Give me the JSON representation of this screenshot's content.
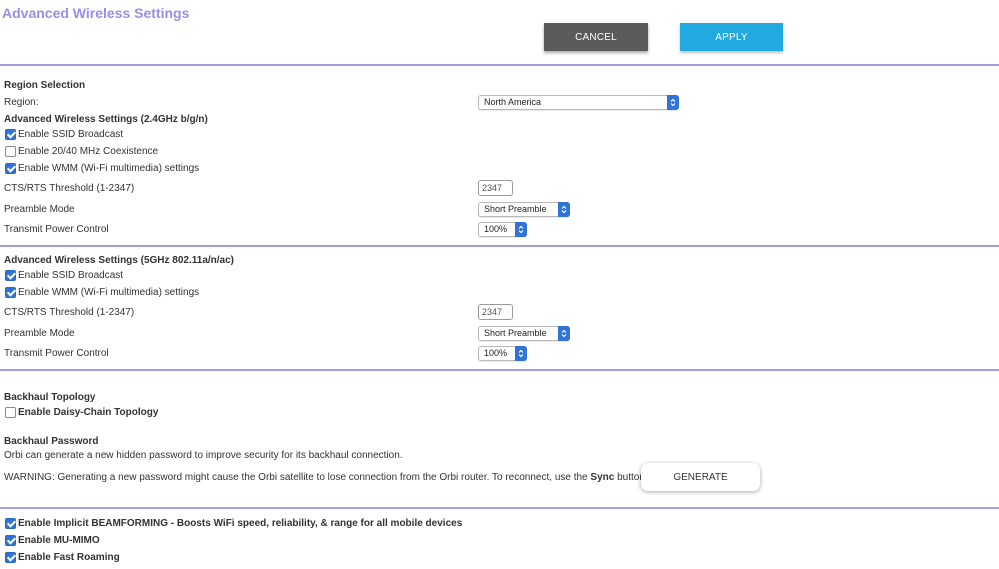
{
  "page": {
    "title": "Advanced Wireless Settings"
  },
  "toolbar": {
    "cancel_label": "CANCEL",
    "apply_label": "APPLY"
  },
  "region": {
    "heading": "Region Selection",
    "label": "Region:",
    "value": "North America"
  },
  "wifi24": {
    "heading": "Advanced Wireless Settings (2.4GHz b/g/n)",
    "ssid_broadcast": {
      "label": "Enable SSID Broadcast",
      "checked": true
    },
    "coexistence": {
      "label": "Enable 20/40 MHz Coexistence",
      "checked": false
    },
    "wmm": {
      "label": "Enable WMM (Wi-Fi multimedia) settings",
      "checked": true
    },
    "cts_label": "CTS/RTS Threshold (1-2347)",
    "cts_value": "2347",
    "preamble_label": "Preamble Mode",
    "preamble_value": "Short Preamble",
    "power_label": "Transmit Power Control",
    "power_value": "100%"
  },
  "wifi5": {
    "heading": "Advanced Wireless Settings (5GHz 802.11a/n/ac)",
    "ssid_broadcast": {
      "label": "Enable SSID Broadcast",
      "checked": true
    },
    "wmm": {
      "label": "Enable WMM (Wi-Fi multimedia) settings",
      "checked": true
    },
    "cts_label": "CTS/RTS Threshold (1-2347)",
    "cts_value": "2347",
    "preamble_label": "Preamble Mode",
    "preamble_value": "Short Preamble",
    "power_label": "Transmit Power Control",
    "power_value": "100%"
  },
  "backhaul": {
    "topology_heading": "Backhaul Topology",
    "daisy_chain": {
      "label": "Enable Daisy-Chain Topology",
      "checked": false
    },
    "password_heading": "Backhaul Password",
    "password_desc": "Orbi can generate a new hidden password to improve security for its backhaul connection.",
    "warning_prefix": "WARNING: Generating a new password might cause the Orbi satellite to lose connection from the Orbi router. To reconnect, use the",
    "warning_bold": "Sync",
    "warning_suffix": "button.",
    "generate_label": "GENERATE"
  },
  "features": {
    "beamforming": {
      "label": "Enable Implicit BEAMFORMING - Boosts WiFi speed, reliability, & range for all mobile devices",
      "checked": true
    },
    "mu_mimo": {
      "label": "Enable MU-MIMO",
      "checked": true
    },
    "fast_roaming": {
      "label": "Enable Fast Roaming",
      "checked": true
    }
  },
  "colors": {
    "accent": "#9b8de8",
    "divider": "#a79be6",
    "apply": "#21a9e1",
    "cancel": "#5b5b5b",
    "checkbox": "#2f74d6"
  }
}
